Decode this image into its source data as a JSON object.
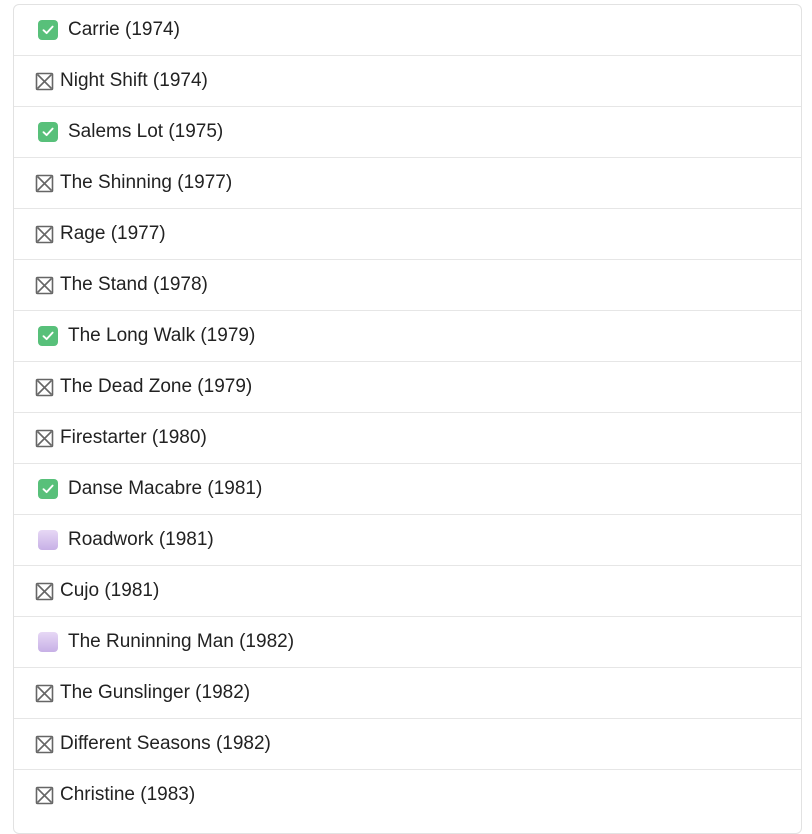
{
  "books": [
    {
      "title": "Carrie (1974)",
      "status": "read",
      "icon": "check-mark-icon"
    },
    {
      "title": "Night Shift (1974)",
      "status": "not-read",
      "icon": "cross-box-icon"
    },
    {
      "title": "Salems Lot (1975)",
      "status": "read",
      "icon": "check-mark-icon"
    },
    {
      "title": "The Shinning (1977)",
      "status": "not-read",
      "icon": "cross-box-icon"
    },
    {
      "title": "Rage (1977)",
      "status": "not-read",
      "icon": "cross-box-icon"
    },
    {
      "title": "The Stand (1978)",
      "status": "not-read",
      "icon": "cross-box-icon"
    },
    {
      "title": "The Long Walk (1979)",
      "status": "read",
      "icon": "check-mark-icon"
    },
    {
      "title": "The Dead Zone (1979)",
      "status": "not-read",
      "icon": "cross-box-icon"
    },
    {
      "title": "Firestarter (1980)",
      "status": "not-read",
      "icon": "cross-box-icon"
    },
    {
      "title": "Danse Macabre (1981)",
      "status": "read",
      "icon": "check-mark-icon"
    },
    {
      "title": "Roadwork (1981)",
      "status": "in-progress",
      "icon": "purple-square-icon"
    },
    {
      "title": "Cujo (1981)",
      "status": "not-read",
      "icon": "cross-box-icon"
    },
    {
      "title": "The Runinning Man (1982)",
      "status": "in-progress",
      "icon": "purple-square-icon"
    },
    {
      "title": "The Gunslinger (1982)",
      "status": "not-read",
      "icon": "cross-box-icon"
    },
    {
      "title": "Different Seasons (1982)",
      "status": "not-read",
      "icon": "cross-box-icon"
    },
    {
      "title": "Christine (1983)",
      "status": "not-read",
      "icon": "cross-box-icon"
    }
  ],
  "colors": {
    "check": "#58c07a",
    "purple": "#c7b0e6",
    "cross": "#666666",
    "text": "#222222",
    "divider": "#e6e6e6"
  }
}
